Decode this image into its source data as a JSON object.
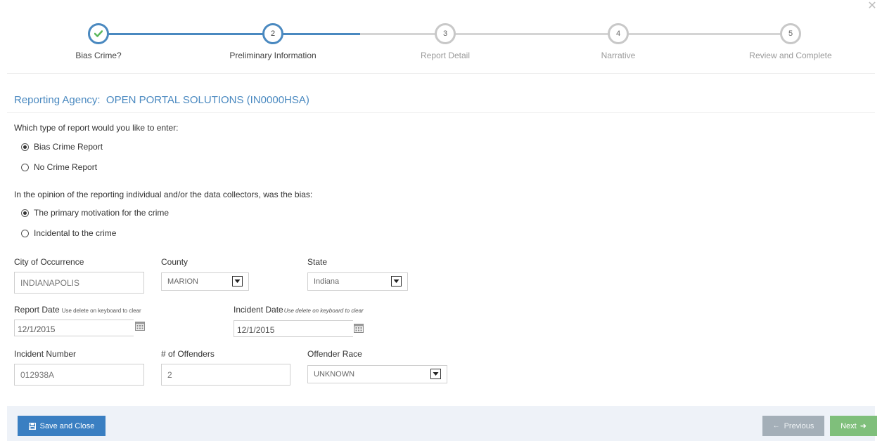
{
  "wizard": {
    "steps": [
      {
        "number": "✔",
        "label": "Bias Crime?",
        "state": "done"
      },
      {
        "number": "2",
        "label": "Preliminary Information",
        "state": "active"
      },
      {
        "number": "3",
        "label": "Report Detail",
        "state": "pending"
      },
      {
        "number": "4",
        "label": "Narrative",
        "state": "pending"
      },
      {
        "number": "5",
        "label": "Review and Complete",
        "state": "pending"
      }
    ]
  },
  "agency": {
    "label": "Reporting Agency:",
    "value": "OPEN PORTAL SOLUTIONS (IN0000HSA)"
  },
  "report_type": {
    "question": "Which type of report would you like to enter:",
    "options": [
      "Bias Crime Report",
      "No Crime Report"
    ],
    "selected": "Bias Crime Report"
  },
  "bias": {
    "question": "In the opinion of the reporting individual and/or the data collectors, was the bias:",
    "options": [
      "The primary motivation for the crime",
      "Incidental to the crime"
    ],
    "selected": "The primary motivation for the crime"
  },
  "city": {
    "label": "City of Occurrence",
    "value": "INDIANAPOLIS"
  },
  "county": {
    "label": "County",
    "value": "MARION"
  },
  "state": {
    "label": "State",
    "value": "Indiana"
  },
  "report_date": {
    "label": "Report Date",
    "hint": "Use delete on keyboard to clear",
    "value": "12/1/2015"
  },
  "incident_date": {
    "label": "Incident Date",
    "hint": "Use delete on keyboard to clear",
    "value": "12/1/2015"
  },
  "incident_number": {
    "label": "Incident Number",
    "value": "012938A"
  },
  "offenders": {
    "label": "# of Offenders",
    "value": "2"
  },
  "offender_race": {
    "label": "Offender Race",
    "value": "UNKNOWN"
  },
  "footer": {
    "save_label": "Save and Close",
    "previous_label": "Previous",
    "next_label": "Next"
  },
  "colors": {
    "accent": "#4a89c0",
    "save_button": "#3a7fc2",
    "previous_button": "#a4afb8",
    "next_button": "#7fbf7b"
  },
  "icons": {
    "close": "close-icon",
    "check": "checkmark-icon",
    "save": "floppy-disk-icon",
    "calendar": "calendar-icon",
    "dropdown": "chevron-down-icon",
    "previous": "arrow-left-icon",
    "next": "arrow-right-icon"
  }
}
